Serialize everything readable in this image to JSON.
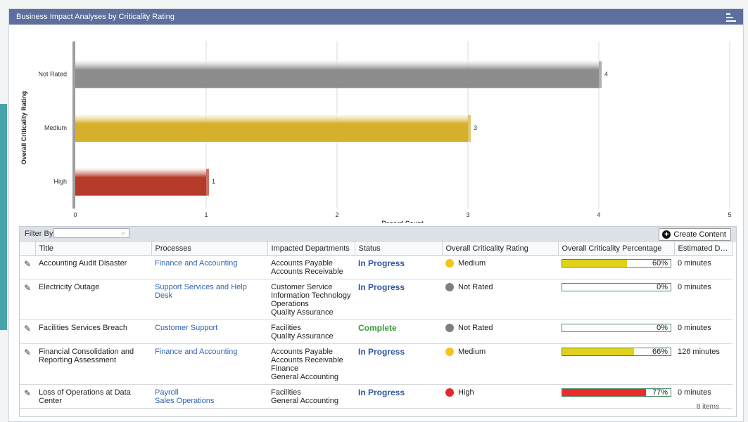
{
  "panel": {
    "title": "Business Impact Analyses by Criticality Rating"
  },
  "colors": {
    "header": "#5d6f9c",
    "link": "#2d64b3",
    "in_progress": "#2f56a3",
    "complete": "#3a9a3a"
  },
  "chart_data": {
    "type": "bar",
    "orientation": "horizontal",
    "categories": [
      "Not Rated",
      "Medium",
      "High"
    ],
    "values": [
      4,
      3,
      1
    ],
    "colors": [
      "#8d8d8d",
      "#d6b02a",
      "#b53a2a"
    ],
    "xlabel": "Record Count",
    "ylabel": "Overall Criticality Rating",
    "xlim": [
      0,
      5
    ],
    "xticks": [
      "0",
      "1",
      "2",
      "3",
      "4",
      "5"
    ],
    "grid": true
  },
  "grid": {
    "filter_label": "Filter By",
    "filter_placeholder": "",
    "create_label": "Create Content",
    "columns": [
      "Title",
      "Processes",
      "Impacted Departments",
      "Status",
      "Overall Criticality Rating",
      "Overall Criticality Percentage",
      "Estimated Do..."
    ],
    "rows": [
      {
        "title": "Accounting Audit Disaster",
        "processes": [
          "Finance and Accounting"
        ],
        "departments": [
          "Accounts Payable",
          "Accounts Receivable"
        ],
        "status": "In Progress",
        "criticality": "Medium",
        "crit_color": "#f5c518",
        "percent_label": "60%",
        "percent": 0.6,
        "bar_color": "#e0d21c",
        "estimated": "0 minutes"
      },
      {
        "title": "Electricity Outage",
        "processes": [
          "Support Services and Help Desk"
        ],
        "departments": [
          "Customer Service",
          "Information Technology",
          "Operations",
          "Quality Assurance"
        ],
        "status": "In Progress",
        "criticality": "Not Rated",
        "crit_color": "#7f7f7f",
        "percent_label": "0%",
        "percent": 0,
        "bar_color": "#e0d21c",
        "estimated": "0 minutes"
      },
      {
        "title": "Facilities Services Breach",
        "processes": [
          "Customer Support"
        ],
        "departments": [
          "Facilities",
          "Quality Assurance"
        ],
        "status": "Complete",
        "criticality": "Not Rated",
        "crit_color": "#7f7f7f",
        "percent_label": "0%",
        "percent": 0,
        "bar_color": "#e0d21c",
        "estimated": "0 minutes"
      },
      {
        "title": "Financial Consolidation and Reporting Assessment",
        "processes": [
          "Finance and Accounting"
        ],
        "departments": [
          "Accounts Payable",
          "Accounts Receivable",
          "Finance",
          "General Accounting"
        ],
        "status": "In Progress",
        "criticality": "Medium",
        "crit_color": "#f5c518",
        "percent_label": "66%",
        "percent": 0.66,
        "bar_color": "#e0d21c",
        "estimated": "126 minutes"
      },
      {
        "title": "Loss of Operations at Data Center",
        "processes": [
          "Payroll",
          "Sales Operations"
        ],
        "departments": [
          "Facilities",
          "General Accounting"
        ],
        "status": "In Progress",
        "criticality": "High",
        "crit_color": "#e02a2a",
        "percent_label": "77%",
        "percent": 0.77,
        "bar_color": "#ee2a2a",
        "estimated": "0 minutes"
      }
    ],
    "items_count": "8 items"
  }
}
